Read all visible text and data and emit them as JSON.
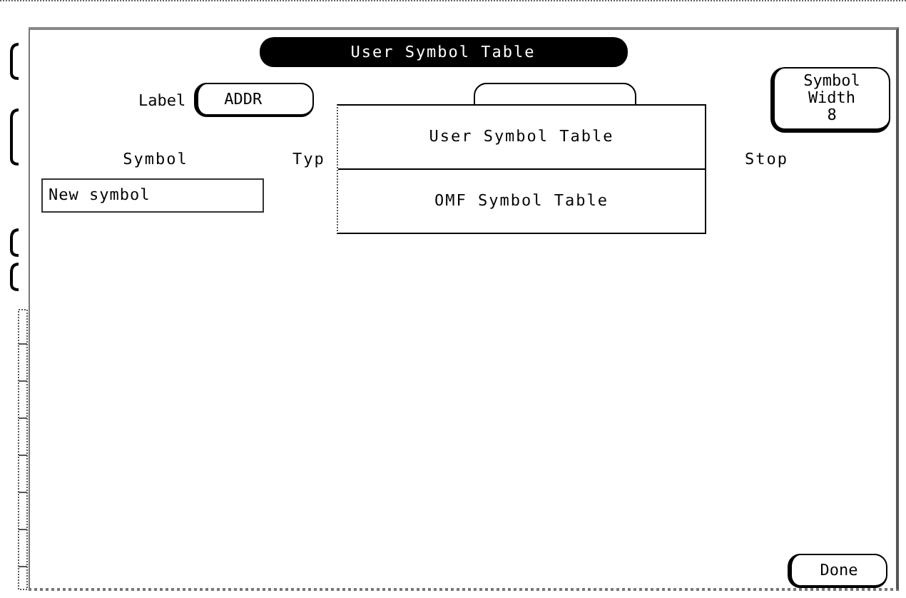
{
  "window": {
    "title": "User Symbol Table"
  },
  "label_field": {
    "label": "Label",
    "value": "ADDR"
  },
  "symbol_width": {
    "label": "Symbol Width",
    "value": "8"
  },
  "columns": [
    "Symbol",
    "Typ",
    "Stop"
  ],
  "symbol_field": {
    "value": "New symbol"
  },
  "popup_menu": {
    "items": [
      {
        "label": "User Symbol Table"
      },
      {
        "label": "OMF Symbol Table"
      }
    ]
  },
  "done_button": {
    "label": "Done"
  }
}
